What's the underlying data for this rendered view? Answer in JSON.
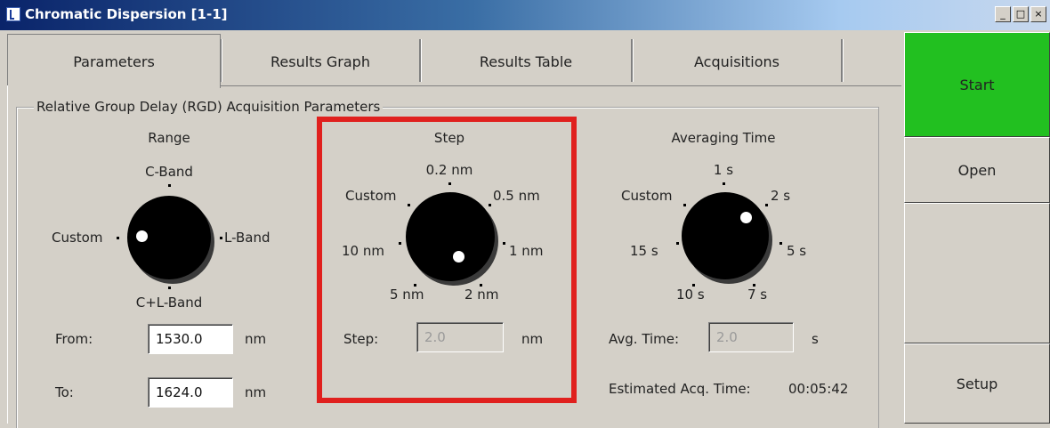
{
  "window": {
    "title": "Chromatic Dispersion [1-1]"
  },
  "window_buttons": [
    "_",
    "□",
    "×"
  ],
  "tabs": [
    {
      "label": "Parameters"
    },
    {
      "label": "Results Graph"
    },
    {
      "label": "Results Table"
    },
    {
      "label": "Acquisitions"
    }
  ],
  "group_title": "Relative Group Delay (RGD) Acquisition Parameters",
  "range": {
    "title": "Range",
    "options": {
      "top": "C-Band",
      "left": "Custom",
      "right": "L-Band",
      "bottom": "C+L-Band"
    },
    "selected": "Custom",
    "from_label": "From:",
    "from_value": "1530.0",
    "from_unit": "nm",
    "to_label": "To:",
    "to_value": "1624.0",
    "to_unit": "nm"
  },
  "step": {
    "title": "Step",
    "options": [
      "0.2 nm",
      "0.5 nm",
      "1 nm",
      "2 nm",
      "5 nm",
      "10 nm",
      "Custom"
    ],
    "selected": "2 nm",
    "step_label": "Step:",
    "step_value": "2.0",
    "step_unit": "nm"
  },
  "averaging": {
    "title": "Averaging Time",
    "options": [
      "1 s",
      "2 s",
      "5 s",
      "7 s",
      "10 s",
      "15 s",
      "Custom"
    ],
    "selected": "2 s",
    "avg_label": "Avg. Time:",
    "avg_value": "2.0",
    "avg_unit": "s",
    "est_label": "Estimated Acq. Time:",
    "est_value": "00:05:42"
  },
  "side_buttons": {
    "start": "Start",
    "open": "Open",
    "setup": "Setup"
  },
  "colors": {
    "start_button": "#22c020",
    "highlight_border": "#e0201e",
    "knob": "#000000"
  }
}
